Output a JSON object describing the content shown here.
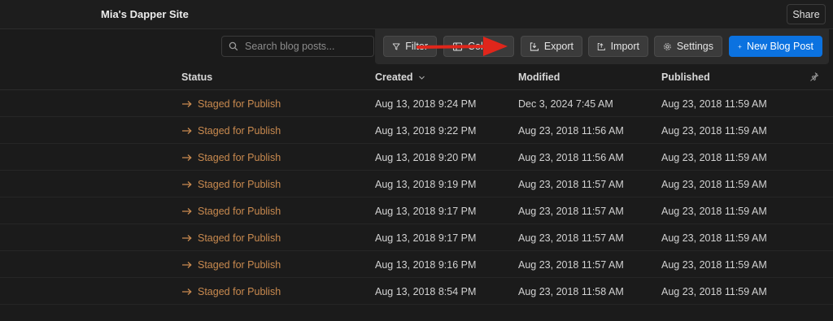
{
  "header": {
    "site_title": "Mia's Dapper Site",
    "share_label": "Share"
  },
  "search": {
    "placeholder": "Search blog posts..."
  },
  "toolbar": {
    "filter_label": "Filter",
    "columns_label": "Col...",
    "export_label": "Export",
    "import_label": "Import",
    "settings_label": "Settings",
    "new_post_label": "New Blog Post"
  },
  "table": {
    "columns": {
      "status": "Status",
      "created": "Created",
      "modified": "Modified",
      "published": "Published"
    },
    "rows": [
      {
        "status": "Staged for Publish",
        "created": "Aug 13, 2018 9:24 PM",
        "modified": "Dec 3, 2024 7:45 AM",
        "published": "Aug 23, 2018 11:59 AM"
      },
      {
        "status": "Staged for Publish",
        "created": "Aug 13, 2018 9:22 PM",
        "modified": "Aug 23, 2018 11:56 AM",
        "published": "Aug 23, 2018 11:59 AM"
      },
      {
        "status": "Staged for Publish",
        "created": "Aug 13, 2018 9:20 PM",
        "modified": "Aug 23, 2018 11:56 AM",
        "published": "Aug 23, 2018 11:59 AM"
      },
      {
        "status": "Staged for Publish",
        "created": "Aug 13, 2018 9:19 PM",
        "modified": "Aug 23, 2018 11:57 AM",
        "published": "Aug 23, 2018 11:59 AM"
      },
      {
        "status": "Staged for Publish",
        "created": "Aug 13, 2018 9:17 PM",
        "modified": "Aug 23, 2018 11:57 AM",
        "published": "Aug 23, 2018 11:59 AM"
      },
      {
        "status": "Staged for Publish",
        "created": "Aug 13, 2018 9:17 PM",
        "modified": "Aug 23, 2018 11:57 AM",
        "published": "Aug 23, 2018 11:59 AM"
      },
      {
        "status": "Staged for Publish",
        "created": "Aug 13, 2018 9:16 PM",
        "modified": "Aug 23, 2018 11:57 AM",
        "published": "Aug 23, 2018 11:59 AM"
      },
      {
        "status": "Staged for Publish",
        "created": "Aug 13, 2018 8:54 PM",
        "modified": "Aug 23, 2018 11:58 AM",
        "published": "Aug 23, 2018 11:59 AM"
      }
    ]
  },
  "colors": {
    "accent": "#0b72e0",
    "status_staged": "#c98a4f",
    "annotation_arrow": "#e0261b"
  },
  "icons": [
    "search-icon",
    "filter-icon",
    "columns-icon",
    "export-icon",
    "import-icon",
    "gear-icon",
    "plus-icon",
    "chevron-down-icon",
    "pin-icon",
    "arrow-right-icon"
  ]
}
